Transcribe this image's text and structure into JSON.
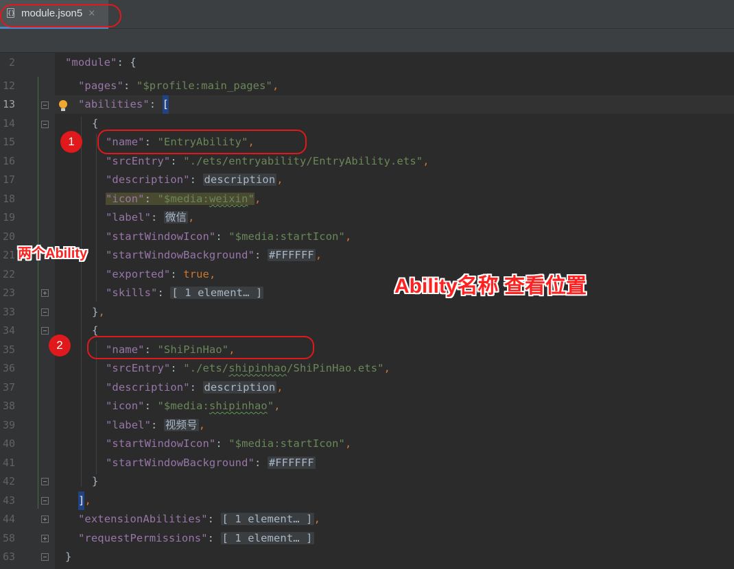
{
  "tab": {
    "filename": "module.json5",
    "close": "×"
  },
  "annotations": {
    "badge1": "1",
    "badge2": "2",
    "left_label": "两个Ability",
    "right_label": "Ability名称  查看位置"
  },
  "lines": [
    {
      "num": "2"
    },
    {
      "num": "12"
    },
    {
      "num": "13"
    },
    {
      "num": "14"
    },
    {
      "num": "15"
    },
    {
      "num": "16"
    },
    {
      "num": "17"
    },
    {
      "num": "18"
    },
    {
      "num": "19"
    },
    {
      "num": "20"
    },
    {
      "num": "21"
    },
    {
      "num": "22"
    },
    {
      "num": "23"
    },
    {
      "num": "33"
    },
    {
      "num": "34"
    },
    {
      "num": "35"
    },
    {
      "num": "36"
    },
    {
      "num": "37"
    },
    {
      "num": "38"
    },
    {
      "num": "39"
    },
    {
      "num": "40"
    },
    {
      "num": "41"
    },
    {
      "num": "42"
    },
    {
      "num": "43"
    },
    {
      "num": "44"
    },
    {
      "num": "58"
    },
    {
      "num": "63"
    }
  ],
  "code": {
    "l2": {
      "key": "\"module\"",
      "rest": ": {"
    },
    "l12": {
      "key": "\"pages\"",
      "val": "\"$profile:main_pages\""
    },
    "l13": {
      "key": "\"abilities\"",
      "bracket": "["
    },
    "l14": {
      "text": "{"
    },
    "l15": {
      "key": "\"name\"",
      "val": "\"EntryAbility\""
    },
    "l16": {
      "key": "\"srcEntry\"",
      "val": "\"./ets/entryability/EntryAbility.ets\""
    },
    "l17": {
      "key": "\"description\"",
      "val": "description"
    },
    "l18": {
      "key": "\"icon\"",
      "val_prefix": "\"$media:",
      "val_word": "weixin",
      "val_suffix": "\""
    },
    "l19": {
      "key": "\"label\"",
      "val": "微信"
    },
    "l20": {
      "key": "\"startWindowIcon\"",
      "val": "\"$media:startIcon\""
    },
    "l21": {
      "key": "\"startWindowBackground\"",
      "val": "#FFFFFF"
    },
    "l22": {
      "key": "\"exported\"",
      "val": "true"
    },
    "l23": {
      "key": "\"skills\"",
      "val": "[ 1 element… ]"
    },
    "l33": {
      "text": "},"
    },
    "l34": {
      "text": "{"
    },
    "l35": {
      "key": "\"name\"",
      "val": "\"ShiPinHao\""
    },
    "l36": {
      "key": "\"srcEntry\"",
      "val_prefix": "\"./ets/",
      "val_word": "shipinhao",
      "val_suffix": "/ShiPinHao.ets\""
    },
    "l37": {
      "key": "\"description\"",
      "val": "description"
    },
    "l38": {
      "key": "\"icon\"",
      "val_prefix": "\"$media:",
      "val_word": "shipinhao",
      "val_suffix": "\""
    },
    "l39": {
      "key": "\"label\"",
      "val": "视频号"
    },
    "l40": {
      "key": "\"startWindowIcon\"",
      "val": "\"$media:startIcon\""
    },
    "l41": {
      "key": "\"startWindowBackground\"",
      "val": "#FFFFFF"
    },
    "l42": {
      "text": "}"
    },
    "l43": {
      "text": "]"
    },
    "l44": {
      "key": "\"extensionAbilities\"",
      "val": "[ 1 element… ]"
    },
    "l58": {
      "key": "\"requestPermissions\"",
      "val": "[ 1 element… ]"
    },
    "l63": {
      "text": "}"
    }
  },
  "colors": {
    "key": "#9876aa",
    "string": "#6a8759",
    "keyword": "#cc7832",
    "annotation": "#e0191c"
  }
}
